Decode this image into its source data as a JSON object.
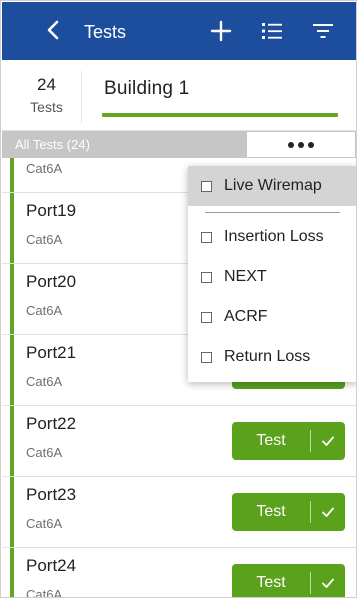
{
  "appbar": {
    "title": "Tests",
    "icons": [
      "chevron-left-icon",
      "plus-icon",
      "list-icon",
      "filter-icon"
    ],
    "color": "#1d4e9d"
  },
  "summary": {
    "count": "24",
    "count_label": "Tests",
    "project": "Building 1",
    "accent": "#64a620"
  },
  "toolbar": {
    "all_tests": "All Tests (24)",
    "more_icon": "more-horizontal-icon"
  },
  "rows": [
    {
      "name": "",
      "type": "Cat6A"
    },
    {
      "name": "Port19",
      "type": "Cat6A"
    },
    {
      "name": "Port20",
      "type": "Cat6A"
    },
    {
      "name": "Port21",
      "type": "Cat6A"
    },
    {
      "name": "Port22",
      "type": "Cat6A"
    },
    {
      "name": "Port23",
      "type": "Cat6A"
    },
    {
      "name": "Port24",
      "type": "Cat6A"
    }
  ],
  "test_button": {
    "label": "Test",
    "color": "#5aa11c"
  },
  "menu": {
    "items": [
      {
        "label": "Live Wiremap",
        "checked": false
      },
      {
        "label": "Insertion Loss",
        "checked": false
      },
      {
        "label": "NEXT",
        "checked": false
      },
      {
        "label": "ACRF",
        "checked": false
      },
      {
        "label": "Return Loss",
        "checked": false
      }
    ]
  }
}
